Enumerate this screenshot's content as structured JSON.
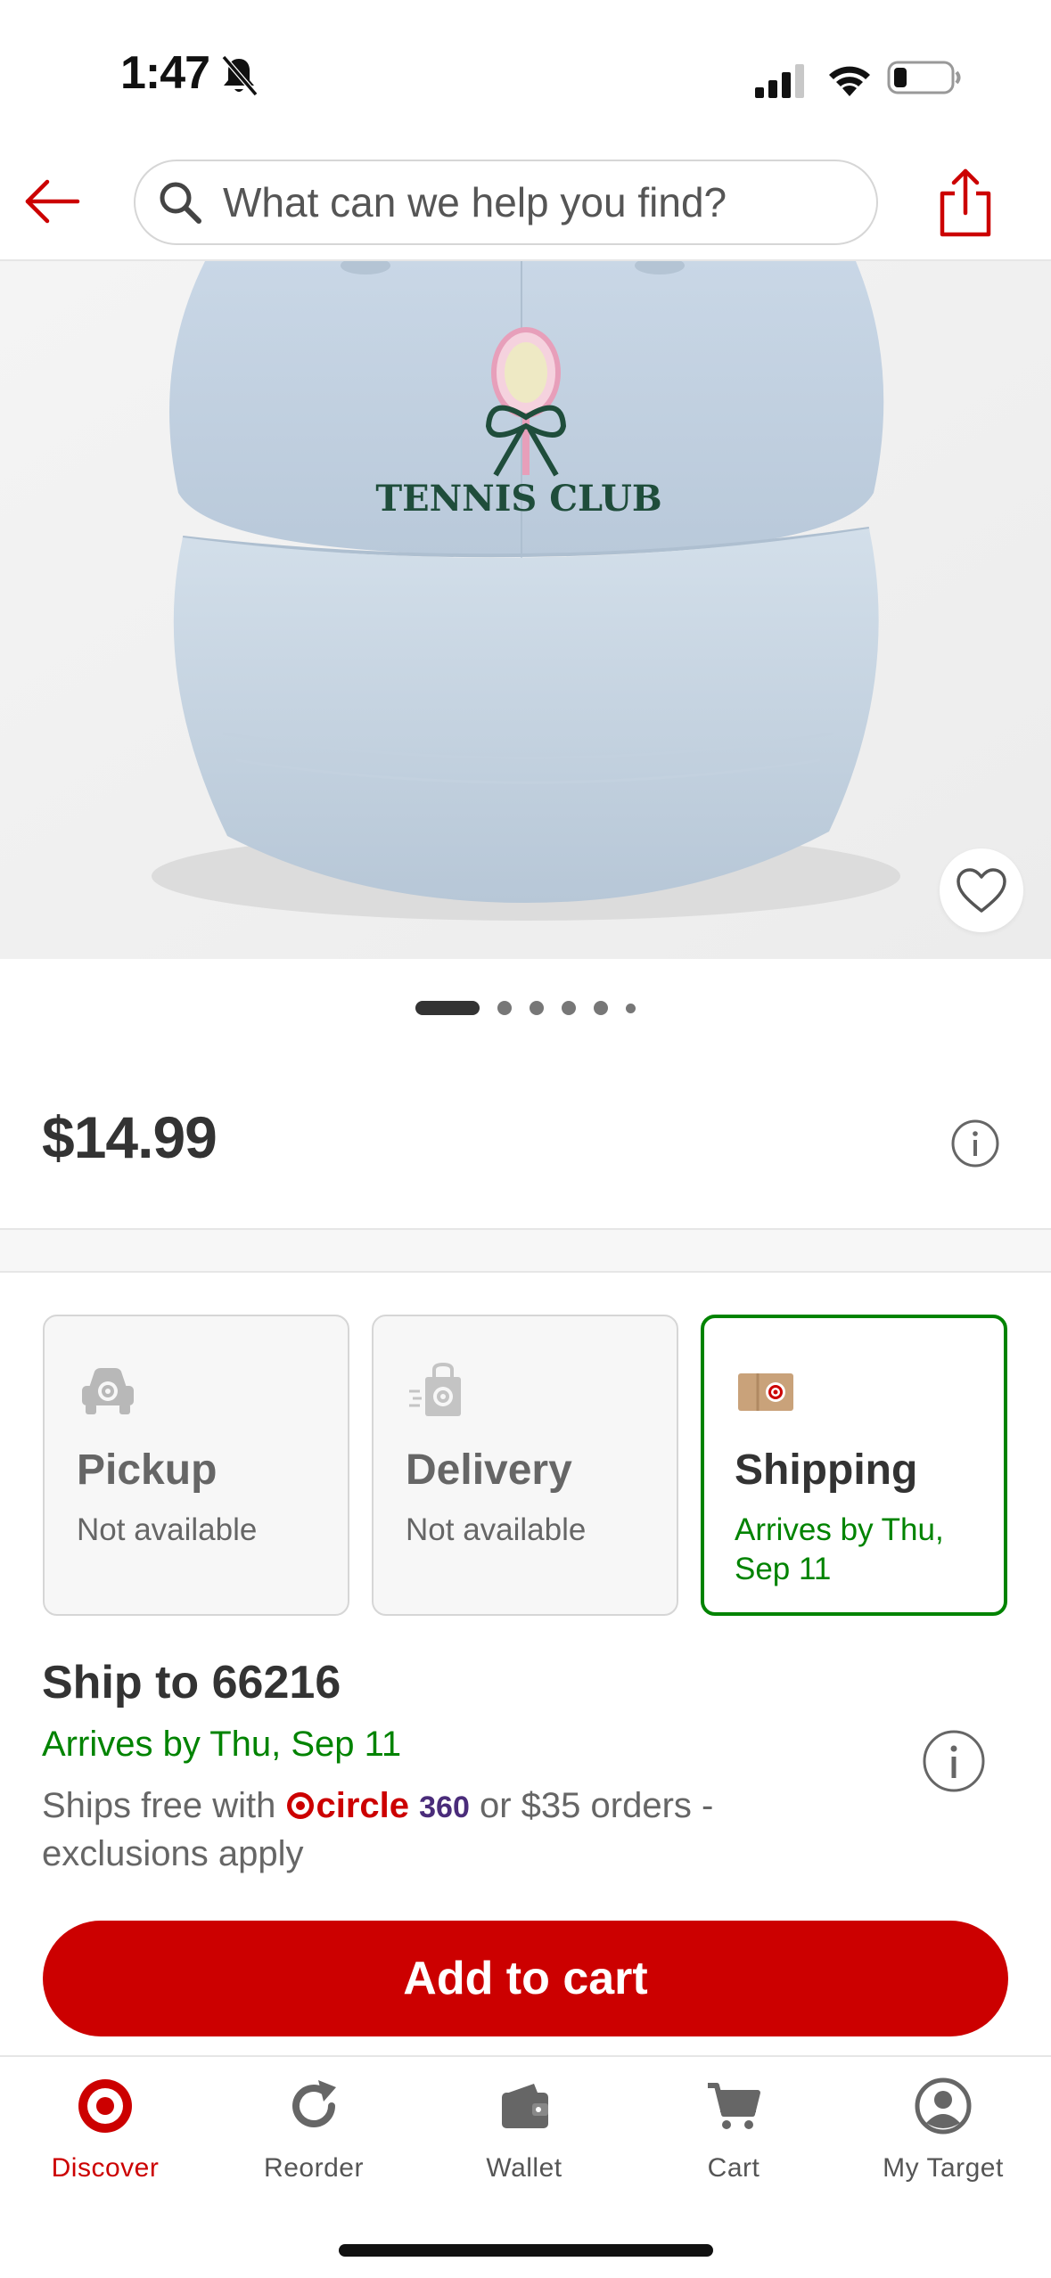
{
  "status_bar": {
    "time": "1:47"
  },
  "header": {
    "search_placeholder": "What can we help you find?"
  },
  "product": {
    "image_text": "TENNIS CLUB",
    "price": "$14.99",
    "carousel_dots": 6,
    "carousel_active_index": 0
  },
  "fulfillment": {
    "options": [
      {
        "title": "Pickup",
        "status": "Not available",
        "selected": false
      },
      {
        "title": "Delivery",
        "status": "Not available",
        "selected": false
      },
      {
        "title": "Shipping",
        "status": "Arrives by Thu, Sep 11",
        "selected": true
      }
    ]
  },
  "shipping": {
    "title": "Ship to 66216",
    "arrives": "Arrives by Thu, Sep 11",
    "note_prefix": "Ships free with",
    "brand_circle": "circle",
    "brand_360": "360",
    "note_suffix": "or $35 orders - exclusions apply"
  },
  "cta": {
    "add_to_cart": "Add to cart"
  },
  "tabbar": {
    "tabs": [
      {
        "label": "Discover",
        "active": true
      },
      {
        "label": "Reorder",
        "active": false
      },
      {
        "label": "Wallet",
        "active": false
      },
      {
        "label": "Cart",
        "active": false
      },
      {
        "label": "My Target",
        "active": false
      }
    ]
  },
  "colors": {
    "brand_red": "#cc0000",
    "success_green": "#008300",
    "text_dark": "#333333",
    "text_muted": "#666666"
  }
}
